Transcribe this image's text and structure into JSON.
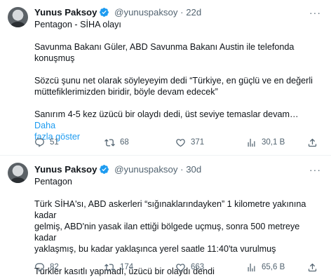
{
  "tweets": [
    {
      "name": "Yunus Paksoy",
      "handle": "@yunuspaksoy",
      "separator": "·",
      "time": "22d",
      "more": "···",
      "lines": [
        "Pentagon - SİHA olayı",
        "Savunma Bakanı Güler, ABD Savunma Bakanı Austin ile telefonda",
        "konuşmuş",
        "Sözcü şunu net olarak söyleyeyim dedi “Türkiye, en güçlü ve en değerli",
        "müttefiklerimizden biridir, böyle devam edecek”",
        "Sanırım 4-5 kez üzücü bir olaydı dedi, üst seviye temaslar devam…",
        "fazla göster"
      ],
      "show_more_part1": "Daha",
      "replies": "51",
      "retweets": "68",
      "likes": "371",
      "views": "30,1 B"
    },
    {
      "name": "Yunus Paksoy",
      "handle": "@yunuspaksoy",
      "separator": "·",
      "time": "30d",
      "more": "···",
      "lines": [
        "Pentagon",
        "Türk SİHA'sı, ABD askerleri “sığınaklarındayken” 1 kilometre yakınına kadar",
        "gelmiş, ABD'nin yasak ilan ettiği bölgede uçmuş, sonra 500 metreye kadar",
        "yaklaşmış, bu kadar yaklaşınca yerel saatle 11:40'ta vurulmuş",
        "Türkler kasıtlı yapmadı, üzücü bir olaydı dendi"
      ],
      "replies": "82",
      "retweets": "174",
      "likes": "663",
      "views": "65,6 B"
    }
  ],
  "icons": {
    "verified": "verified-badge-icon",
    "reply": "reply-icon",
    "retweet": "retweet-icon",
    "like": "heart-icon",
    "views": "views-icon",
    "share": "share-icon"
  },
  "colors": {
    "link": "#1d9bf0",
    "muted": "#536471",
    "text": "#0f1419",
    "divider": "#eff3f4"
  }
}
